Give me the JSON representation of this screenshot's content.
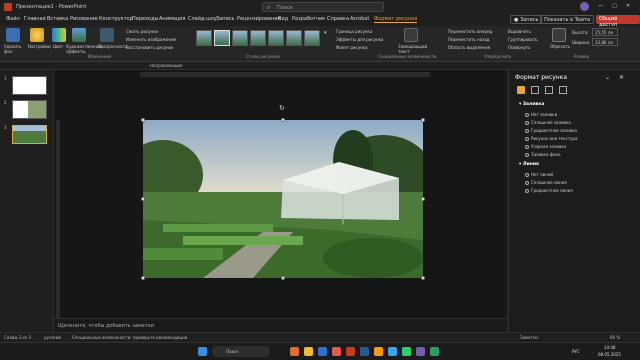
{
  "titlebar": {
    "autosave": "Автосохранение",
    "filename": "Презентация1 - PowerPoint",
    "search_placeholder": "Поиск",
    "window_controls": [
      "—",
      "□",
      "✕"
    ]
  },
  "tabs": [
    "Файл",
    "Главная",
    "Вставка",
    "Рисование",
    "Конструктор",
    "Переходы",
    "Анимация",
    "Слайд-шоу",
    "Запись",
    "Рецензирование",
    "Вид",
    "Разработчик",
    "Справка",
    "Acrobat",
    "Формат рисунка"
  ],
  "active_tab": "Формат рисунка",
  "tab_actions": {
    "record": "Запись",
    "teams": "Показать в Teams",
    "share": "Общий доступ"
  },
  "ribbon": {
    "remove_bg": "Удалить фон",
    "corrections": "Настройки",
    "color": "Цвет",
    "artistic": "Художественные эффекты",
    "transparency": "Прозрачность",
    "compress": "Сжать рисунки",
    "change": "Изменить изображение",
    "reset": "Восстановить рисунок",
    "group_adjust": "Изменение",
    "group_styles": "Стили рисунков",
    "border": "Граница рисунка",
    "effects": "Эффекты для рисунка",
    "layout": "Макет рисунка",
    "alt_text": "Замещающий текст",
    "group_access": "Специальные возможности",
    "forward": "Переместить вперед",
    "backward": "Переместить назад",
    "selection": "Область выделения",
    "align": "Выровнять",
    "group_obj": "Группировать",
    "rotate": "Повернуть",
    "group_arrange": "Упорядочить",
    "crop": "Обрезать",
    "height_label": "Высота:",
    "height": "15,55 см",
    "width_label": "Ширина:",
    "width": "33,86 см",
    "group_size": "Размер"
  },
  "qbar": {
    "shape_label": "Направляющие"
  },
  "slides": [
    {
      "num": "1"
    },
    {
      "num": "2"
    },
    {
      "num": "3"
    }
  ],
  "notes_placeholder": "Щелкните, чтобы добавить заметки",
  "pane": {
    "title": "Формат рисунка",
    "section_fill": "Заливка",
    "fill_items": [
      "Нет заливки",
      "Сплошная заливка",
      "Градиентная заливка",
      "Рисунок или текстура",
      "Узорная заливка",
      "Заливка фона"
    ],
    "section_line": "Линия",
    "line_items": [
      "Нет линий",
      "Сплошная линия",
      "Градиентная линия"
    ]
  },
  "status": {
    "slide": "Слайд 3 из 3",
    "lang": "русский",
    "accessibility": "Специальные возможности: проверьте рекомендации",
    "notes": "Заметки",
    "zoom": "66 %"
  },
  "taskbar": {
    "search": "Поиск",
    "lang": "РУС",
    "time": "14:48",
    "date": "08.05.2025"
  },
  "colors": {
    "accent": "#e8a33b",
    "share": "#c0392b",
    "teams": "#5b5fc7"
  }
}
